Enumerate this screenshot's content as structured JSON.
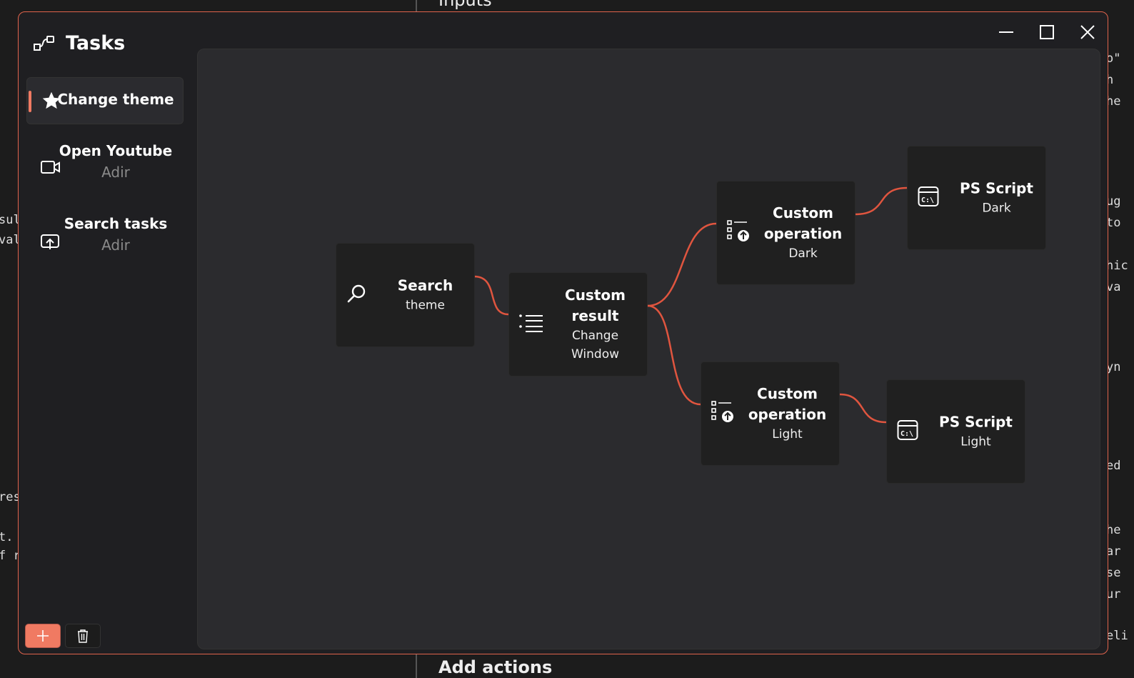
{
  "background": {
    "heading_top": "Inputs",
    "heading_bottom": "Add actions",
    "left_fragments": [
      "sul",
      "val",
      "res",
      "t.",
      "f r"
    ],
    "right_fragments": [
      "o\"",
      "h",
      "he",
      "ug",
      "to",
      "hic",
      "va",
      "yn",
      "ed",
      "he",
      "ar",
      "se",
      "ur",
      "eli"
    ]
  },
  "app": {
    "title": "Tasks",
    "accent": "#f07a62"
  },
  "sidebar": {
    "items": [
      {
        "label": "Change theme",
        "sub": "",
        "icon": "star-icon",
        "active": true
      },
      {
        "label": "Open Youtube",
        "sub": "Adir",
        "icon": "video-icon"
      },
      {
        "label": "Search tasks",
        "sub": "Adir",
        "icon": "share-screen-icon"
      }
    ]
  },
  "footer": {
    "add_icon": "plus-icon",
    "delete_icon": "trash-icon"
  },
  "graph": {
    "nodes": [
      {
        "title": "Search",
        "subtitle": "theme",
        "icon": "search-icon"
      },
      {
        "title": "Custom result",
        "subtitle": "Change Window",
        "icon": "list-icon"
      },
      {
        "title": "Custom operation",
        "subtitle": "Dark",
        "icon": "custom-operation-icon"
      },
      {
        "title": "PS Script",
        "subtitle": "Dark",
        "icon": "terminal-icon"
      },
      {
        "title": "Custom operation",
        "subtitle": "Light",
        "icon": "custom-operation-icon"
      },
      {
        "title": "PS Script",
        "subtitle": "Light",
        "icon": "terminal-icon"
      }
    ],
    "edges": [
      [
        "Search",
        "Custom result"
      ],
      [
        "Custom result",
        "Custom operation Dark"
      ],
      [
        "Custom result",
        "Custom operation Light"
      ],
      [
        "Custom operation Dark",
        "PS Script Dark"
      ],
      [
        "Custom operation Light",
        "PS Script Light"
      ]
    ]
  }
}
